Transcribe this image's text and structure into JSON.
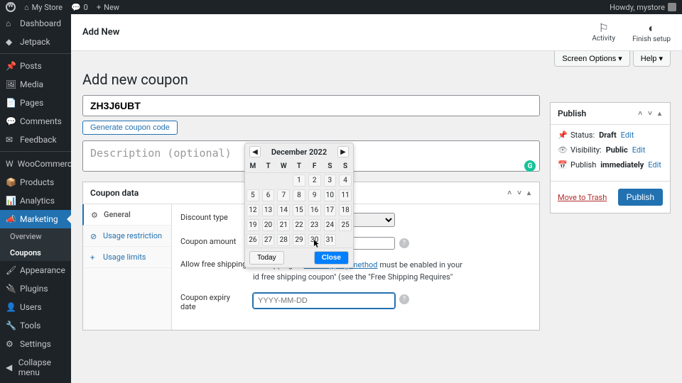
{
  "adminbar": {
    "site_name": "My Store",
    "comments_count": "0",
    "new_label": "New",
    "howdy": "Howdy, mystore"
  },
  "sidebar": {
    "items": [
      {
        "label": "Dashboard",
        "icon": "⌂"
      },
      {
        "label": "Jetpack",
        "icon": "◆"
      },
      {
        "label": "Posts",
        "icon": "📌"
      },
      {
        "label": "Media",
        "icon": "🖼"
      },
      {
        "label": "Pages",
        "icon": "📄"
      },
      {
        "label": "Comments",
        "icon": "💬"
      },
      {
        "label": "Feedback",
        "icon": "✉"
      },
      {
        "label": "WooCommerce",
        "icon": "W"
      },
      {
        "label": "Products",
        "icon": "📦"
      },
      {
        "label": "Analytics",
        "icon": "📊"
      },
      {
        "label": "Marketing",
        "icon": "📣",
        "active": true
      },
      {
        "label": "Appearance",
        "icon": "🖌"
      },
      {
        "label": "Plugins",
        "icon": "🔌"
      },
      {
        "label": "Users",
        "icon": "👤"
      },
      {
        "label": "Tools",
        "icon": "🔧"
      },
      {
        "label": "Settings",
        "icon": "⚙"
      }
    ],
    "submenu": [
      {
        "label": "Overview"
      },
      {
        "label": "Coupons",
        "active": true
      }
    ],
    "collapse_label": "Collapse menu"
  },
  "header": {
    "title": "Add New",
    "activity_label": "Activity",
    "finish_label": "Finish setup"
  },
  "screen_options": {
    "screen_options_label": "Screen Options ▾",
    "help_label": "Help ▾"
  },
  "page": {
    "heading": "Add new coupon",
    "coupon_code": "ZH3J6UBT",
    "generate_btn": "Generate coupon code",
    "description_placeholder": "Description (optional)",
    "description_value": ""
  },
  "coupon_data": {
    "panel_title": "Coupon data",
    "tabs": [
      {
        "label": "General",
        "icon": "⚙",
        "active": true
      },
      {
        "label": "Usage restriction",
        "icon": "⊘"
      },
      {
        "label": "Usage limits",
        "icon": "+"
      }
    ],
    "discount_type_label": "Discount type",
    "discount_type_selected": "",
    "amount_label": "Coupon amount",
    "amount_value": "",
    "free_shipping_label": "Allow free shipping",
    "free_shipping_text_1": "ee shipping. A ",
    "free_shipping_link": "free shipping method",
    "free_shipping_text_2": " must be enabled in your",
    "free_shipping_text_3": "id free shipping coupon\" (see the \"Free Shipping Requires\"",
    "expiry_label": "Coupon expiry date",
    "expiry_placeholder": "YYYY-MM-DD",
    "expiry_value": ""
  },
  "datepicker": {
    "month_year": "December 2022",
    "dow": [
      "M",
      "T",
      "W",
      "T",
      "F",
      "S",
      "S"
    ],
    "weeks": [
      [
        "",
        "",
        "",
        "1",
        "2",
        "3",
        "4"
      ],
      [
        "5",
        "6",
        "7",
        "8",
        "9",
        "10",
        "11"
      ],
      [
        "12",
        "13",
        "14",
        "15",
        "16",
        "17",
        "18"
      ],
      [
        "19",
        "20",
        "21",
        "22",
        "23",
        "24",
        "25"
      ],
      [
        "26",
        "27",
        "28",
        "29",
        "30",
        "31",
        ""
      ]
    ],
    "today_label": "Today",
    "close_label": "Close"
  },
  "publish": {
    "panel_title": "Publish",
    "status_label": "Status:",
    "status_value": "Draft",
    "visibility_label": "Visibility:",
    "visibility_value": "Public",
    "publish_when_label": "Publish",
    "publish_when_value": "immediately",
    "edit_label": "Edit",
    "trash_label": "Move to Trash",
    "publish_btn": "Publish"
  }
}
